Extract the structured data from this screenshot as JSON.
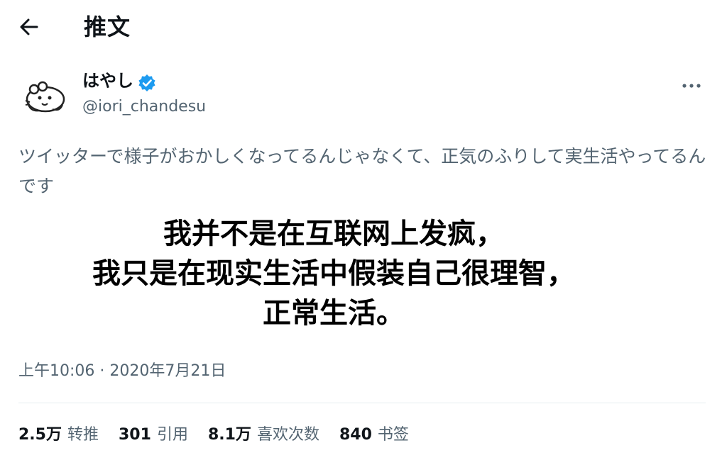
{
  "header": {
    "title": "推文",
    "back_icon": "arrow-left-icon"
  },
  "author": {
    "display_name": "はやし",
    "handle": "@iori_chandesu",
    "verified": true,
    "verified_color": "#1d9bf0",
    "avatar_icon": "cartoon-animal-avatar",
    "more_icon": "more-horizontal-icon"
  },
  "tweet": {
    "text": "ツイッターで様子がおかしくなってるんじゃなくて、正気のふりして実生活やってるんです",
    "overlay_lines": [
      "我并不是在互联网上发疯，",
      "我只是在现实生活中假装自己很理智，",
      "正常生活。"
    ],
    "timestamp": "上午10:06 · 2020年7月21日"
  },
  "stats": [
    {
      "value": "2.5万",
      "label": "转推"
    },
    {
      "value": "301",
      "label": "引用"
    },
    {
      "value": "8.1万",
      "label": "喜欢次数"
    },
    {
      "value": "840",
      "label": "书签"
    }
  ],
  "colors": {
    "primary_text": "#0f1419",
    "secondary_text": "#536471",
    "divider": "#e6ecf0",
    "verified": "#1d9bf0"
  }
}
